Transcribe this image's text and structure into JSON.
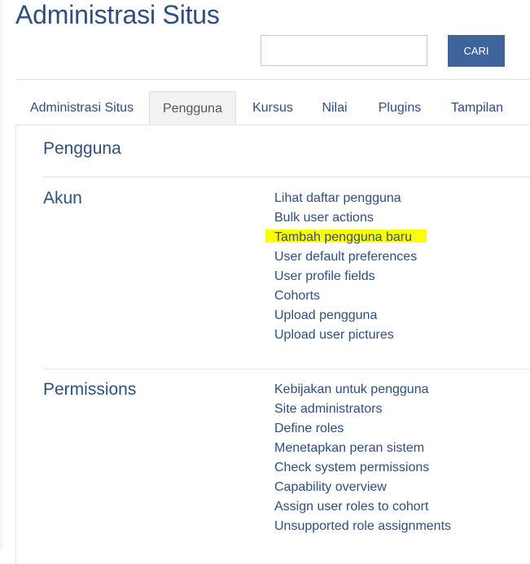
{
  "page": {
    "title": "Administrasi Situs"
  },
  "search": {
    "value": "",
    "placeholder": "",
    "button_label": "CARI"
  },
  "tabs": [
    {
      "label": "Administrasi Situs",
      "active": false
    },
    {
      "label": "Pengguna",
      "active": true
    },
    {
      "label": "Kursus",
      "active": false
    },
    {
      "label": "Nilai",
      "active": false
    },
    {
      "label": "Plugins",
      "active": false
    },
    {
      "label": "Tampilan",
      "active": false
    }
  ],
  "content": {
    "heading": "Pengguna",
    "sections": [
      {
        "title": "Akun",
        "links": [
          "Lihat daftar pengguna",
          "Bulk user actions",
          "Tambah pengguna baru",
          "User default preferences",
          "User profile fields",
          "Cohorts",
          "Upload pengguna",
          "Upload user pictures"
        ],
        "highlighted_link": "Tambah pengguna baru"
      },
      {
        "title": "Permissions",
        "links": [
          "Kebijakan untuk pengguna",
          "Site administrators",
          "Define roles",
          "Menetapkan peran sistem",
          "Check system permissions",
          "Capability overview",
          "Assign user roles to cohort",
          "Unsupported role assignments"
        ]
      }
    ]
  },
  "colors": {
    "brand": "#2e4f7f",
    "button": "#3f639b",
    "highlight": "#ffff00",
    "active_tab_bg": "#f2f2f2"
  }
}
